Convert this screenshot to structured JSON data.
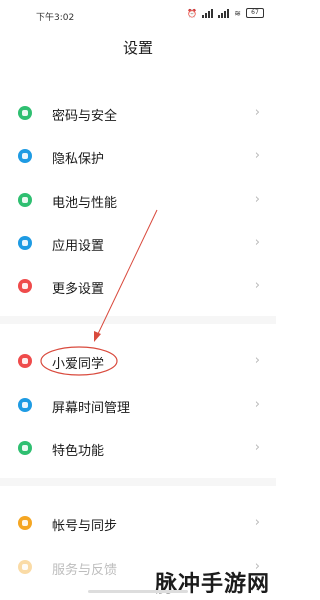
{
  "status_bar": {
    "time": "下午3:02",
    "signal_1_label": "5G",
    "signal_2_label": "5G",
    "battery": "67"
  },
  "page": {
    "title": "设置"
  },
  "settings": [
    {
      "label": "密码与安全",
      "icon": "lock-icon",
      "color": "#2fbf71"
    },
    {
      "label": "隐私保护",
      "icon": "privacy-icon",
      "color": "#1e9be3"
    },
    {
      "label": "电池与性能",
      "icon": "battery-icon",
      "color": "#2fbf71"
    },
    {
      "label": "应用设置",
      "icon": "apps-icon",
      "color": "#1e9be3"
    },
    {
      "label": "更多设置",
      "icon": "more-icon",
      "color": "#ef4b4b"
    },
    {
      "label": "小爱同学",
      "icon": "assistant-icon",
      "color": "#ef4b4b"
    },
    {
      "label": "屏幕时间管理",
      "icon": "hourglass-icon",
      "color": "#1e9be3"
    },
    {
      "label": "特色功能",
      "icon": "feature-icon",
      "color": "#2fbf71"
    },
    {
      "label": "帐号与同步",
      "icon": "account-icon",
      "color": "#f5a623"
    },
    {
      "label": "服务与反馈",
      "icon": "feedback-icon",
      "color": "#f5a623"
    }
  ],
  "chevron": "›",
  "watermark": "脉冲手游网"
}
